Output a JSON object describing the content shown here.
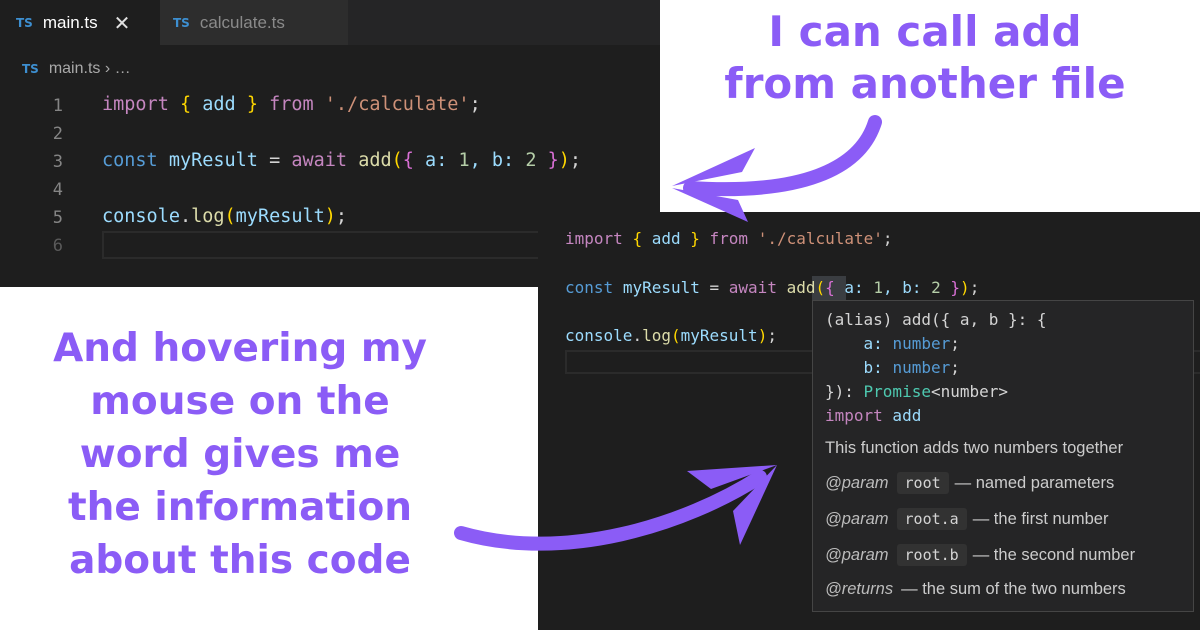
{
  "top_editor": {
    "tabs": [
      {
        "lang": "TS",
        "label": "main.ts",
        "close": "✕"
      },
      {
        "lang": "TS",
        "label": "calculate.ts"
      }
    ],
    "breadcrumb": {
      "lang": "TS",
      "file": "main.ts",
      "sep": " › …"
    },
    "line_numbers": [
      "1",
      "2",
      "3",
      "4",
      "5",
      "6"
    ],
    "lines": {
      "l1": [
        "import",
        " ",
        "{",
        " add ",
        "}",
        " from ",
        "'./calculate'",
        ";"
      ],
      "l3": [
        "const",
        " ",
        "myResult",
        " = ",
        "await",
        " ",
        "add",
        "(",
        "{",
        " a: ",
        "1",
        ", b: ",
        "2",
        " ",
        "}",
        ")",
        ";"
      ],
      "l5": [
        "console",
        ".",
        "log",
        "(",
        "myResult",
        ")",
        ";"
      ]
    }
  },
  "bottom_editor": {
    "hover": {
      "sig1": "(alias) add({ a, b }: {",
      "sig2_key": "    a: ",
      "sig2_type": "number",
      "sig2_end": ";",
      "sig3_key": "    b: ",
      "sig3_type": "number",
      "sig3_end": ";",
      "sig4_start": "}): ",
      "sig4_type": "Promise",
      "sig4_end": "<number>",
      "import_kw": "import",
      "import_name": " add",
      "description": "This function adds two numbers together",
      "params": [
        {
          "tag": "@param",
          "name": "root",
          "desc": "— named parameters"
        },
        {
          "tag": "@param",
          "name": "root.a",
          "desc": "— the first number"
        },
        {
          "tag": "@param",
          "name": "root.b",
          "desc": "— the second number"
        }
      ],
      "returns": {
        "tag": "@returns",
        "desc": "— the sum of the two numbers"
      }
    }
  },
  "annotations": {
    "top": [
      "I can call add",
      "from another file"
    ],
    "left": [
      "And hovering my",
      "mouse on the",
      "word gives me",
      "the information",
      "about this code"
    ]
  },
  "colors": {
    "accent": "#8b5cf6",
    "editor_bg": "#1e1e1e",
    "popup_bg": "#252526"
  }
}
